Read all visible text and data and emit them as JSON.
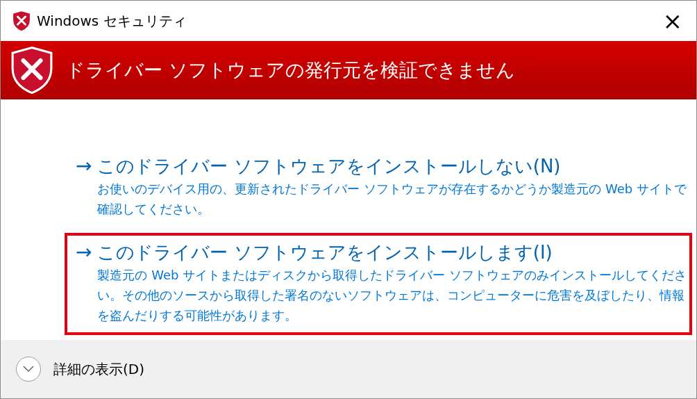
{
  "window": {
    "title": "Windows セキュリティ",
    "close": "×"
  },
  "banner": {
    "heading": "ドライバー ソフトウェアの発行元を検証できません"
  },
  "options": [
    {
      "arrow": "→",
      "title": "このドライバー ソフトウェアをインストールしない(N)",
      "description": "お使いのデバイス用の、更新されたドライバー ソフトウェアが存在するかどうか製造元の Web サイトで確認してください。",
      "highlighted": false
    },
    {
      "arrow": "→",
      "title": "このドライバー ソフトウェアをインストールします(I)",
      "description": "製造元の Web サイトまたはディスクから取得したドライバー ソフトウェアのみインストールしてください。その他のソースから取得した署名のないソフトウェアは、コンピューターに危害を及ぼしたり、情報を盗んだりする可能性があります。",
      "highlighted": true
    }
  ],
  "footer": {
    "details": "詳細の表示(D)",
    "expanded": false
  }
}
